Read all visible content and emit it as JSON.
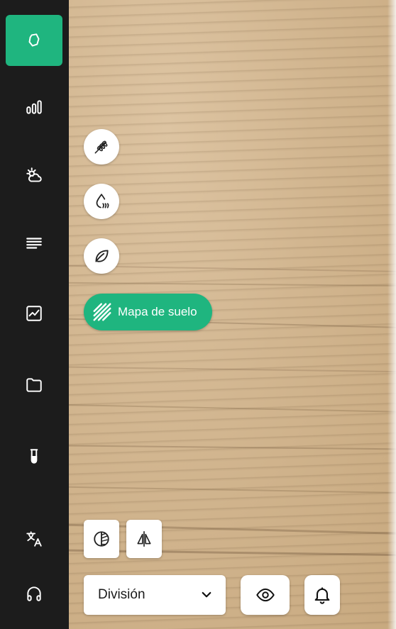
{
  "sidebar": {
    "items": [
      {
        "icon": "map-region-icon",
        "active": true
      },
      {
        "icon": "bar-chart-icon"
      },
      {
        "icon": "weather-sun-cloud-icon"
      },
      {
        "icon": "list-lines-icon"
      },
      {
        "icon": "trend-chart-icon"
      },
      {
        "icon": "folder-icon"
      },
      {
        "icon": "test-tube-icon"
      },
      {
        "icon": "translate-icon"
      },
      {
        "icon": "headphones-icon"
      }
    ]
  },
  "layers": {
    "items": [
      {
        "icon": "wheat-icon"
      },
      {
        "icon": "water-drop-icon"
      },
      {
        "icon": "leaf-icon"
      }
    ],
    "active": {
      "icon": "soil-hatch-icon",
      "label": "Mapa de suelo"
    }
  },
  "tools": {
    "contrast_icon": "contrast-icon",
    "compare_icon": "split-compare-icon"
  },
  "division_select": {
    "value": "División"
  },
  "visibility_icon": "eye-icon",
  "notifications_icon": "bell-icon",
  "colors": {
    "accent": "#1fb57f",
    "sidebar": "#1c1c1c"
  }
}
